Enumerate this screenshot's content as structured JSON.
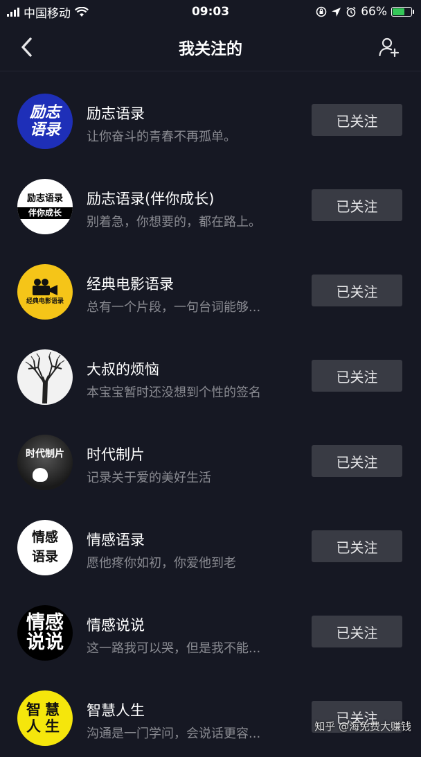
{
  "status_bar": {
    "carrier": "中国移动",
    "time": "09:03",
    "battery_percent": "66%",
    "battery_level": 0.66,
    "battery_color": "#35c759"
  },
  "nav": {
    "title": "我关注的",
    "back_icon": "chevron-left-icon",
    "add_friend_icon": "add-user-icon"
  },
  "follow_label": "已关注",
  "accounts": [
    {
      "name": "励志语录",
      "desc": "让你奋斗的青春不再孤单。",
      "avatar_lines": [
        "励志",
        "语录"
      ]
    },
    {
      "name": "励志语录(伴你成长)",
      "desc": "别着急，你想要的，都在路上。",
      "avatar_lines": [
        "励志语录",
        "伴你成长"
      ]
    },
    {
      "name": "经典电影语录",
      "desc": "总有一个片段，一句台词能够...",
      "avatar_lines": [
        "经典电影语录"
      ]
    },
    {
      "name": "大叔的烦恼",
      "desc": "本宝宝暂时还没想到个性的签名",
      "avatar_lines": []
    },
    {
      "name": "时代制片",
      "desc": "记录关于爱的美好生活",
      "avatar_lines": [
        "时代制片"
      ]
    },
    {
      "name": "情感语录",
      "desc": "愿他疼你如初，你爱他到老",
      "avatar_lines": [
        "情感",
        "语录"
      ]
    },
    {
      "name": "情感说说",
      "desc": "这一路我可以哭，但是我不能...",
      "avatar_lines": [
        "情感",
        "说说"
      ]
    },
    {
      "name": "智慧人生",
      "desc": "沟通是一门学问，会说话更容...",
      "avatar_lines": [
        "智慧",
        "人生"
      ]
    }
  ],
  "watermark": "知乎 @海免费大赚钱"
}
